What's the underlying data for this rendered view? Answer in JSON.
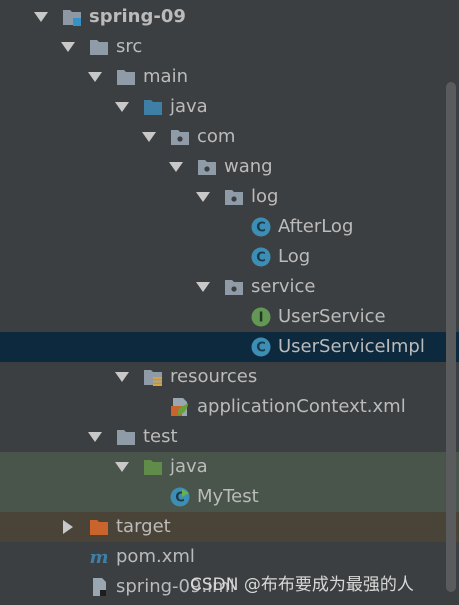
{
  "tree": {
    "project": "spring-09",
    "src": "src",
    "main": "main",
    "java_main": "java",
    "com": "com",
    "wang": "wang",
    "log": "log",
    "afterlog": "AfterLog",
    "logclass": "Log",
    "service": "service",
    "userservice": "UserService",
    "userserviceimpl": "UserServiceImpl",
    "resources": "resources",
    "appcontext": "applicationContext.xml",
    "test": "test",
    "java_test": "java",
    "mytest": "MyTest",
    "target": "target",
    "pom": "pom.xml",
    "iml": "spring-09.iml"
  },
  "watermark": "CSDN @布布要成为最强的人",
  "colors": {
    "background": "#3c3f41",
    "selection": "#0d293e",
    "test_folder": "#49544a",
    "excluded_folder": "#4a4438",
    "class_icon": "#3d8eb5",
    "interface_icon": "#629755",
    "source_folder": "#3f7ea5",
    "test_source_folder": "#5f8c48",
    "target_folder": "#c8642c"
  }
}
